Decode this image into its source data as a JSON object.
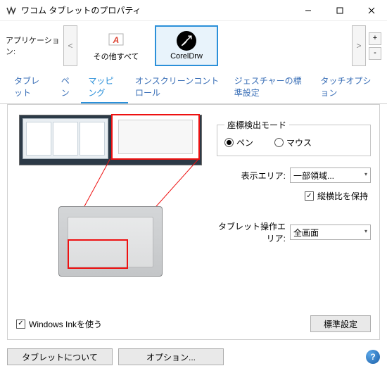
{
  "window": {
    "title": "ワコム タブレットのプロパティ"
  },
  "appbar": {
    "label": "アプリケーション:",
    "prev": "<",
    "next": ">",
    "add": "+",
    "remove": "-",
    "items": [
      {
        "label": "その他すべて",
        "icon": "generic-app-icon",
        "selected": false
      },
      {
        "label": "CorelDrw",
        "icon": "coreldraw-icon",
        "selected": true
      }
    ]
  },
  "tabs": {
    "items": [
      "タブレット",
      "ペン",
      "マッピング",
      "オンスクリーンコントロール",
      "ジェスチャーの標準設定",
      "タッチオプション"
    ],
    "active_index": 2
  },
  "mapping": {
    "mode_legend": "座標検出モード",
    "mode_pen": "ペン",
    "mode_mouse": "マウス",
    "mode_value": "pen",
    "display_area_label": "表示エリア:",
    "display_area_value": "一部領域...",
    "keep_aspect": "縦横比を保持",
    "keep_aspect_checked": true,
    "tablet_area_label": "タブレット操作エリア:",
    "tablet_area_value": "全画面",
    "windows_ink": "Windows Inkを使う",
    "windows_ink_checked": true,
    "defaults_btn": "標準設定"
  },
  "footer": {
    "about": "タブレットについて",
    "options": "オプション..."
  }
}
